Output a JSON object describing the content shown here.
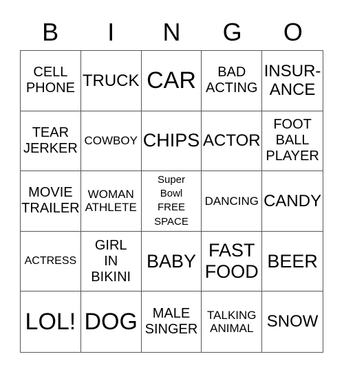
{
  "header": [
    "B",
    "I",
    "N",
    "G",
    "O"
  ],
  "cells": [
    {
      "text": "CELL\nPHONE",
      "size": "md"
    },
    {
      "text": "TRUCK",
      "size": "lg"
    },
    {
      "text": "CAR",
      "size": "xxl"
    },
    {
      "text": "BAD\nACTING",
      "size": "md"
    },
    {
      "text": "INSUR-\nANCE",
      "size": "lg"
    },
    {
      "text": "TEAR\nJERKER",
      "size": "md"
    },
    {
      "text": "COWBOY",
      "size": "sm"
    },
    {
      "text": "CHIPS",
      "size": "xl"
    },
    {
      "text": "ACTOR",
      "size": "lg"
    },
    {
      "text": "FOOT\nBALL\nPLAYER",
      "size": "md"
    },
    {
      "text": "MOVIE\nTRAILER",
      "size": "md"
    },
    {
      "text": "WOMAN\nATHLETE",
      "size": "sm"
    },
    {
      "text": "Super\nBowl\nFREE\nSPACE",
      "size": "free"
    },
    {
      "text": "DANCING",
      "size": "sm"
    },
    {
      "text": "CANDY",
      "size": "lg"
    },
    {
      "text": "ACTRESS",
      "size": "xs"
    },
    {
      "text": "GIRL\nIN\nBIKINI",
      "size": "md"
    },
    {
      "text": "BABY",
      "size": "xl"
    },
    {
      "text": "FAST\nFOOD",
      "size": "xl"
    },
    {
      "text": "BEER",
      "size": "xl"
    },
    {
      "text": "LOL!",
      "size": "xxl"
    },
    {
      "text": "DOG",
      "size": "xxl"
    },
    {
      "text": "MALE\nSINGER",
      "size": "md"
    },
    {
      "text": "TALKING\nANIMAL",
      "size": "sm"
    },
    {
      "text": "SNOW",
      "size": "lg"
    }
  ]
}
